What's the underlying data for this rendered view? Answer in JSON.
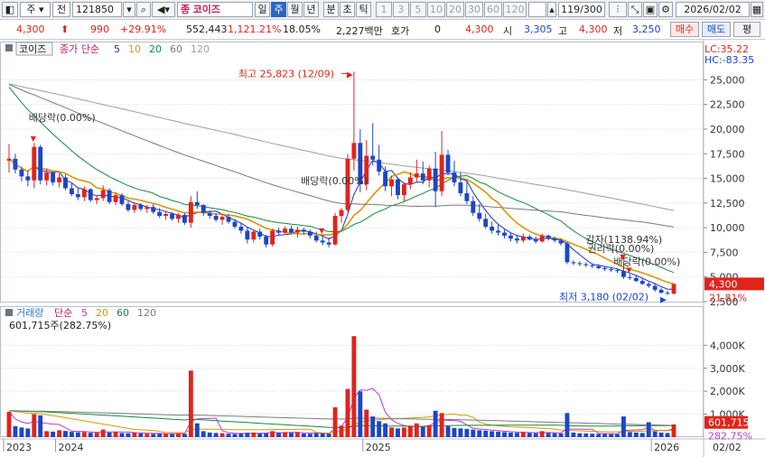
{
  "toolbar": {
    "menu_glyph": "◧",
    "market": "주",
    "type": "전",
    "code": "121850",
    "stock_name": "코이즈",
    "stock_badge": "종",
    "periods": [
      "일",
      "주",
      "월",
      "년"
    ],
    "active_period": "주",
    "intraday": [
      "분",
      "초",
      "틱"
    ],
    "minutes": [
      "1",
      "3",
      "5",
      "10",
      "20",
      "30",
      "60",
      "120"
    ],
    "bars": "119/300",
    "date": "2026/02/02"
  },
  "quote": {
    "price": "4,300",
    "change": "990",
    "change_pct": "+29.91%",
    "volume": "552,443",
    "volume_ratio": "1,121.21%",
    "turnover": "18.05%",
    "amount": "2,227백만",
    "hoga_label": "호가",
    "hoga": "0",
    "ask_price": "4,300",
    "open_label": "시",
    "open": "3,305",
    "high_label": "고",
    "high": "4,300",
    "low_label": "저",
    "low": "3,250",
    "buy_label": "매수",
    "sell_label": "매도",
    "eval_label": "평"
  },
  "colors": {
    "up": "#e0241b",
    "down": "#1b46c8",
    "ma5": "#1b2fd0",
    "ma10": "#d99a00",
    "ma20": "#128a3a",
    "ma60": "#7a7a7a",
    "ma120": "#9e9e9e",
    "volume_ma5": "#b83ad6"
  },
  "chart_data": {
    "type": "candlestick",
    "price_panel": {
      "stock_label": "코이즈",
      "ma_label": "종가 단순",
      "ma_periods": [
        "5",
        "10",
        "20",
        "60",
        "120"
      ],
      "lc": "LC:35.22",
      "hc": "HC:-83.35",
      "ylim": [
        2500,
        26500
      ],
      "yticks": [
        2500,
        5000,
        7500,
        10000,
        12500,
        15000,
        17500,
        20000,
        22500,
        25000
      ],
      "ytick_labels": [
        "2,500",
        "5,000",
        "7,500",
        "10,000",
        "12,500",
        "15,000",
        "17,500",
        "20,000",
        "22,500",
        "25,000"
      ],
      "current_price_label": "4,300",
      "current_price": 4300,
      "current_pct_label": "21.81%",
      "high_annotation": "최고 25,823 (12/09)",
      "high_value": 25823,
      "low_annotation": "최저 3,180 (02/02)",
      "low_value": 3180,
      "events": [
        {
          "label": "배당락(0.00%)",
          "index": 4
        },
        {
          "label": "배당락(0.00%)",
          "index": 50
        },
        {
          "label": "감자(1138.94%)",
          "index": 98
        },
        {
          "label": "권리락(0.00%)",
          "index": 98
        },
        {
          "label": "배당락(0.00%)",
          "index": 99
        }
      ]
    },
    "volume_panel": {
      "label": "거래량",
      "ma_label": "단순",
      "ma_periods": [
        "5",
        "20",
        "60",
        "120"
      ],
      "summary": "601,715주(282.75%)",
      "ylim": [
        0,
        4800000
      ],
      "yticks": [
        1000000,
        2000000,
        3000000,
        4000000
      ],
      "ytick_labels": [
        "1,000K",
        "2,000K",
        "3,000K",
        "4,000K"
      ],
      "current_volume_label": "601,715",
      "current_volume": 601715,
      "current_pct_label": "282.75%"
    },
    "x_labels": [
      {
        "label": "2023",
        "index": 0
      },
      {
        "label": "2024",
        "index": 8
      },
      {
        "label": "2025",
        "index": 57
      },
      {
        "label": "2026",
        "index": 103
      }
    ],
    "last_date_label": "02/02",
    "candles": [
      [
        16800,
        18500,
        15600,
        17000,
        1100000
      ],
      [
        17000,
        17500,
        15500,
        15900,
        480000
      ],
      [
        15900,
        16200,
        14700,
        15200,
        420000
      ],
      [
        15200,
        15800,
        14200,
        14800,
        380000
      ],
      [
        14800,
        18600,
        14000,
        18200,
        1000000
      ],
      [
        18200,
        18400,
        14400,
        14800,
        950000
      ],
      [
        14800,
        16000,
        14300,
        15600,
        260000
      ],
      [
        15600,
        15700,
        14300,
        14600,
        240000
      ],
      [
        14600,
        15500,
        14100,
        15100,
        300000
      ],
      [
        15100,
        15400,
        13800,
        14000,
        270000
      ],
      [
        14000,
        14600,
        13200,
        13400,
        230000
      ],
      [
        13400,
        14000,
        12800,
        13100,
        210000
      ],
      [
        13100,
        14200,
        12700,
        13900,
        220000
      ],
      [
        13900,
        14000,
        12600,
        12800,
        190000
      ],
      [
        12800,
        13200,
        12400,
        13000,
        200000
      ],
      [
        13000,
        14300,
        12700,
        13800,
        330000
      ],
      [
        13800,
        14000,
        12400,
        12600,
        200000
      ],
      [
        12600,
        13600,
        12300,
        13300,
        230000
      ],
      [
        13300,
        13500,
        12200,
        12400,
        180000
      ],
      [
        12400,
        12700,
        11600,
        11800,
        170000
      ],
      [
        11800,
        12600,
        11500,
        12300,
        200000
      ],
      [
        12300,
        12500,
        11700,
        11900,
        160000
      ],
      [
        11900,
        12300,
        11500,
        12100,
        150000
      ],
      [
        12100,
        12400,
        11400,
        11600,
        140000
      ],
      [
        11600,
        12000,
        11000,
        11200,
        150000
      ],
      [
        11200,
        11700,
        10800,
        11400,
        150000
      ],
      [
        11400,
        11600,
        10700,
        10900,
        130000
      ],
      [
        10900,
        11500,
        10500,
        11300,
        160000
      ],
      [
        11300,
        11500,
        10300,
        10500,
        140000
      ],
      [
        10500,
        13200,
        10000,
        12600,
        2900000
      ],
      [
        12600,
        13700,
        11900,
        12300,
        600000
      ],
      [
        12300,
        12400,
        11200,
        11500,
        260000
      ],
      [
        11500,
        11800,
        10900,
        11200,
        200000
      ],
      [
        11200,
        11500,
        10600,
        10800,
        180000
      ],
      [
        10800,
        11400,
        10300,
        11100,
        170000
      ],
      [
        11100,
        11400,
        10400,
        10600,
        150000
      ],
      [
        10600,
        10900,
        9900,
        10100,
        140000
      ],
      [
        10100,
        10500,
        9400,
        9700,
        160000
      ],
      [
        9700,
        10000,
        8400,
        8800,
        190000
      ],
      [
        8800,
        9800,
        8500,
        9600,
        200000
      ],
      [
        9600,
        9900,
        8800,
        9100,
        160000
      ],
      [
        9100,
        9300,
        8000,
        8300,
        170000
      ],
      [
        8300,
        9900,
        8100,
        9700,
        260000
      ],
      [
        9700,
        10000,
        9300,
        9500,
        180000
      ],
      [
        9500,
        10100,
        9400,
        9900,
        220000
      ],
      [
        9900,
        10200,
        9300,
        9500,
        190000
      ],
      [
        9500,
        10100,
        9000,
        9800,
        210000
      ],
      [
        9800,
        10000,
        9300,
        9600,
        160000
      ],
      [
        9600,
        9800,
        8900,
        9200,
        150000
      ],
      [
        9200,
        9600,
        8500,
        8700,
        170000
      ],
      [
        8700,
        9300,
        8200,
        8500,
        160000
      ],
      [
        8500,
        9000,
        8000,
        8300,
        150000
      ],
      [
        8300,
        11500,
        8200,
        11200,
        1300000
      ],
      [
        11200,
        12000,
        10500,
        11800,
        500000
      ],
      [
        11800,
        17500,
        11600,
        17000,
        2100000
      ],
      [
        17000,
        25823,
        15800,
        18600,
        4400000
      ],
      [
        18600,
        20000,
        13600,
        14400,
        2000000
      ],
      [
        14400,
        18900,
        13800,
        17300,
        1200000
      ],
      [
        17300,
        20600,
        16300,
        16900,
        900000
      ],
      [
        16900,
        18400,
        15300,
        15700,
        700000
      ],
      [
        15700,
        16200,
        13700,
        14200,
        600000
      ],
      [
        14200,
        15300,
        13200,
        14900,
        420000
      ],
      [
        14900,
        15100,
        12900,
        13300,
        380000
      ],
      [
        13300,
        14600,
        12700,
        14400,
        420000
      ],
      [
        14400,
        15600,
        13900,
        15100,
        500000
      ],
      [
        15100,
        16900,
        14700,
        15500,
        600000
      ],
      [
        15500,
        16700,
        14400,
        14800,
        450000
      ],
      [
        14800,
        16300,
        14100,
        16000,
        520000
      ],
      [
        16000,
        17700,
        12100,
        13700,
        1150000
      ],
      [
        13700,
        19800,
        13200,
        17400,
        1050000
      ],
      [
        17400,
        17900,
        15300,
        15600,
        480000
      ],
      [
        15600,
        16800,
        14200,
        14600,
        400000
      ],
      [
        14600,
        15600,
        13200,
        13500,
        380000
      ],
      [
        13500,
        14800,
        12400,
        12700,
        360000
      ],
      [
        12700,
        13200,
        11200,
        11500,
        330000
      ],
      [
        11500,
        12400,
        10600,
        10900,
        300000
      ],
      [
        10900,
        11400,
        9900,
        10100,
        280000
      ],
      [
        10100,
        10600,
        9400,
        9700,
        260000
      ],
      [
        9700,
        10400,
        9200,
        9500,
        240000
      ],
      [
        9500,
        9800,
        8900,
        9200,
        220000
      ],
      [
        9200,
        9500,
        8600,
        8900,
        200000
      ],
      [
        8900,
        9300,
        8400,
        8700,
        190000
      ],
      [
        8700,
        9400,
        8500,
        9100,
        220000
      ],
      [
        9100,
        9300,
        8700,
        8800,
        180000
      ],
      [
        8800,
        9100,
        8400,
        8600,
        170000
      ],
      [
        8600,
        9400,
        8500,
        9200,
        260000
      ],
      [
        9200,
        9300,
        8700,
        8900,
        180000
      ],
      [
        8900,
        9100,
        8500,
        8700,
        170000
      ],
      [
        8700,
        8900,
        8200,
        8400,
        160000
      ],
      [
        8400,
        8600,
        6300,
        6500,
        1050000
      ],
      [
        6500,
        6700,
        6200,
        6400,
        200000
      ],
      [
        6400,
        6600,
        6100,
        6300,
        170000
      ],
      [
        6300,
        6500,
        6000,
        6200,
        160000
      ],
      [
        6200,
        6400,
        5900,
        6100,
        150000
      ],
      [
        6100,
        6300,
        5800,
        5900,
        140000
      ],
      [
        5900,
        6100,
        5600,
        5800,
        140000
      ],
      [
        5800,
        6000,
        5500,
        5700,
        130000
      ],
      [
        5700,
        5900,
        5400,
        5600,
        130000
      ],
      [
        5600,
        6600,
        4800,
        5000,
        900000
      ],
      [
        5000,
        5300,
        4700,
        4900,
        220000
      ],
      [
        4900,
        5100,
        4500,
        4600,
        200000
      ],
      [
        4600,
        4800,
        4200,
        4300,
        180000
      ],
      [
        4300,
        4500,
        3900,
        4100,
        650000
      ],
      [
        4100,
        4300,
        3500,
        3700,
        250000
      ],
      [
        3700,
        3900,
        3300,
        3400,
        200000
      ],
      [
        3400,
        3600,
        3180,
        3310,
        180000
      ],
      [
        3305,
        4300,
        3250,
        4300,
        552443
      ]
    ]
  }
}
